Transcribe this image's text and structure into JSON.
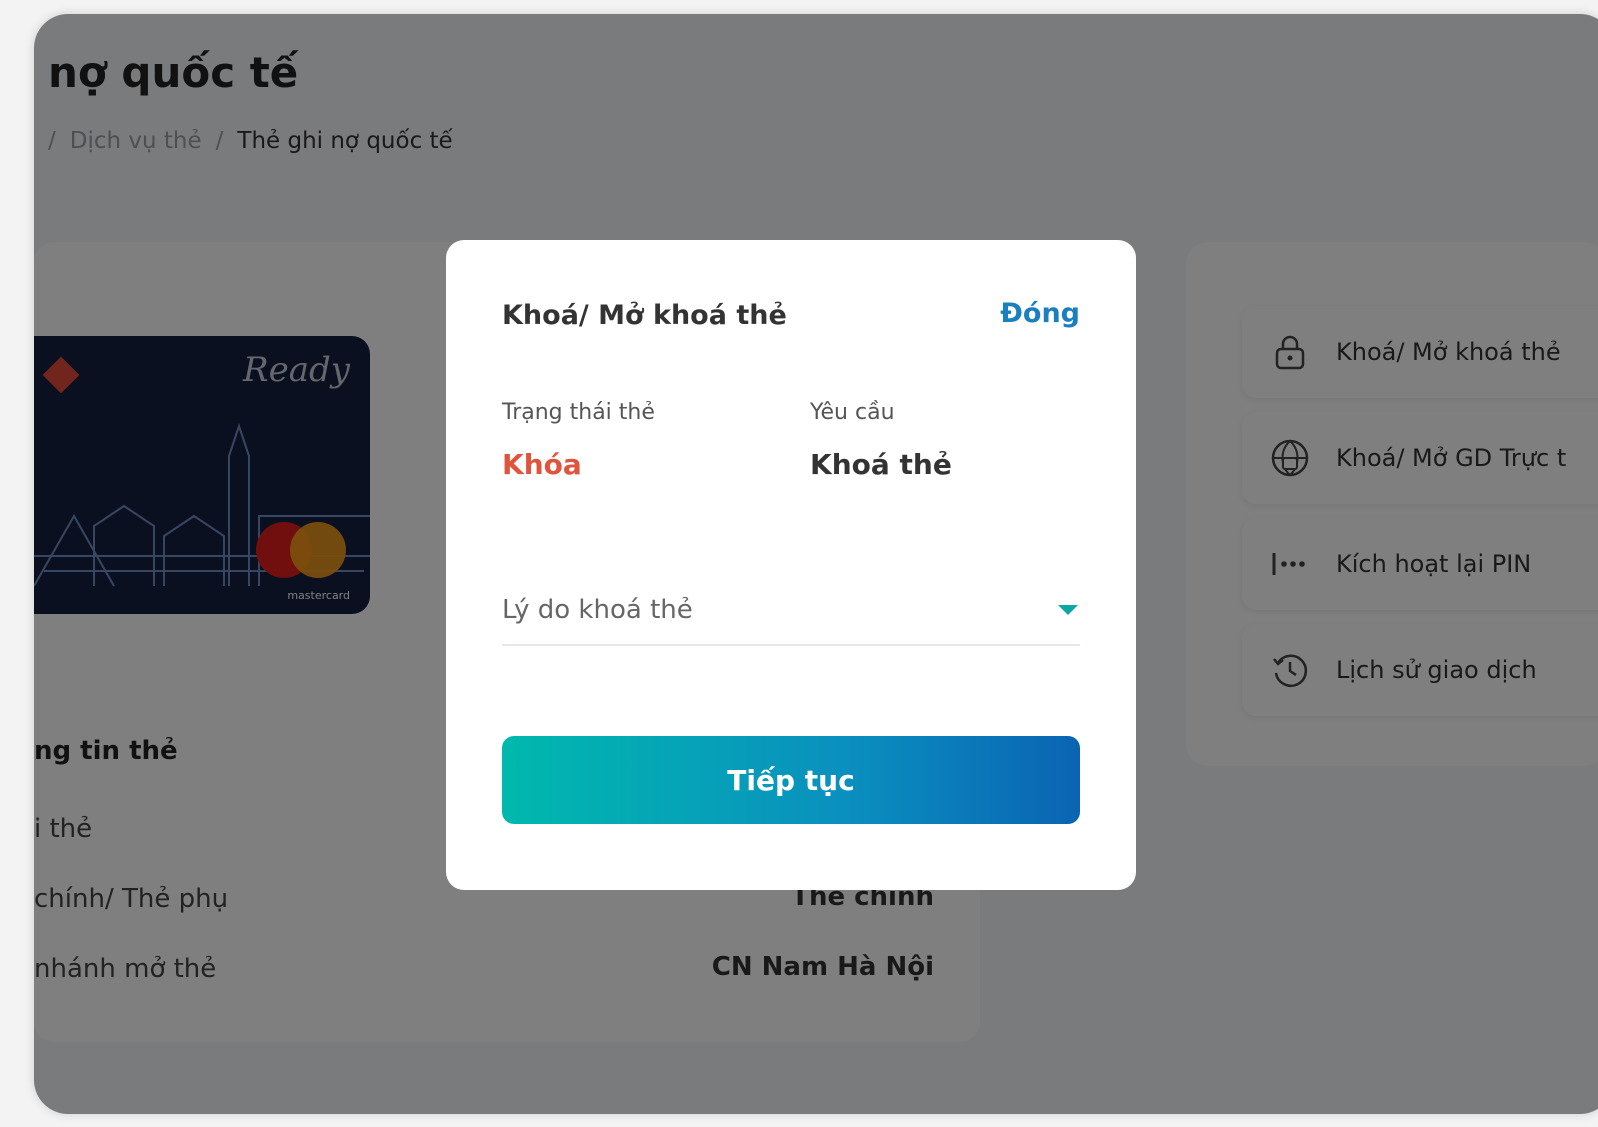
{
  "page": {
    "title": "nợ quốc tế",
    "breadcrumb": {
      "sep1": "/",
      "item": "Dịch vụ thẻ",
      "sep2": "/",
      "current": "Thẻ ghi nợ quốc tế"
    }
  },
  "card": {
    "script": "Ready",
    "brand": "mastercard"
  },
  "info": {
    "title": "ng tin thẻ",
    "rows": [
      {
        "label": "i thẻ",
        "value": ""
      },
      {
        "label": "chính/ Thẻ phụ",
        "value": "Thẻ chính"
      },
      {
        "label": "nhánh mở thẻ",
        "value": "CN Nam Hà Nội"
      }
    ]
  },
  "actions": [
    {
      "label": "Khoá/ Mở khoá thẻ",
      "icon": "lock-icon"
    },
    {
      "label": "Khoá/ Mở GD Trực t",
      "icon": "globe-lock-icon"
    },
    {
      "label": "Kích hoạt lại PIN",
      "icon": "pin-dots-icon"
    },
    {
      "label": "Lịch sử giao dịch",
      "icon": "history-icon"
    }
  ],
  "modal": {
    "title": "Khoá/ Mở khoá thẻ",
    "close": "Đóng",
    "status_label": "Trạng thái thẻ",
    "status_value": "Khóa",
    "request_label": "Yêu cầu",
    "request_value": "Khoá thẻ",
    "reason_placeholder": "Lý do khoá thẻ",
    "continue": "Tiếp tục"
  },
  "colors": {
    "status": "#e0533d",
    "link": "#1a7fbf",
    "accent": "#0aa7a3"
  }
}
